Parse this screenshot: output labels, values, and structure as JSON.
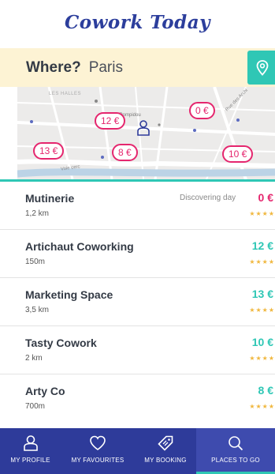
{
  "app": {
    "title": "Cowork Today"
  },
  "search": {
    "label": "Where?",
    "city": "Paris"
  },
  "map": {
    "street_labels": [
      "LES HALLES",
      "Centre Pompidou",
      "Rue des Archi",
      "Voie cerc"
    ],
    "pins": [
      {
        "label": "12 €"
      },
      {
        "label": "0 €"
      },
      {
        "label": "13 €"
      },
      {
        "label": "8 €"
      },
      {
        "label": "10 €"
      }
    ]
  },
  "places": [
    {
      "name": "Mutinerie",
      "distance": "1,2 km",
      "note": "Discovering day",
      "price": "0 €",
      "price_color": "#e5266e",
      "stars": "★★★★"
    },
    {
      "name": "Artichaut Coworking",
      "distance": "150m",
      "note": "",
      "price": "12 €",
      "price_color": "#2fc7b5",
      "stars": "★★★★"
    },
    {
      "name": "Marketing Space",
      "distance": "3,5 km",
      "note": "",
      "price": "13 €",
      "price_color": "#2fc7b5",
      "stars": "★★★★"
    },
    {
      "name": "Tasty Cowork",
      "distance": "2 km",
      "note": "",
      "price": "10 €",
      "price_color": "#2fc7b5",
      "stars": "★★★★"
    },
    {
      "name": "Arty Co",
      "distance": "700m",
      "note": "",
      "price": "8 €",
      "price_color": "#2fc7b5",
      "stars": "★★★★"
    }
  ],
  "nav": {
    "profile": "MY PROFILE",
    "favourites": "MY FAVOURITES",
    "booking": "MY BOOKING",
    "places": "PLACES TO GO"
  },
  "colors": {
    "brand": "#2c3e9c",
    "accent": "#2fc7b5",
    "price_pin": "#e5266e",
    "nav_bg": "#2e3b9a",
    "search_bg": "#fdf3d4"
  }
}
